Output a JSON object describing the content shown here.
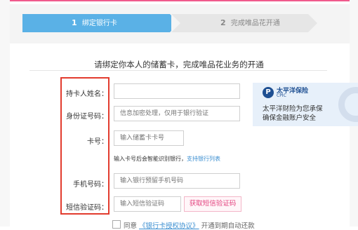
{
  "steps": [
    {
      "num": "1",
      "label": "绑定银行卡",
      "active": true
    },
    {
      "num": "2",
      "label": "完成唯品花开通",
      "active": false
    }
  ],
  "intro": "请绑定你本人的储蓄卡，完成唯品花业务的开通",
  "form": {
    "name_label": "持卡人姓名：",
    "name_value": "",
    "id_label": "身份证号码：",
    "id_placeholder": "信息加密处理，仅用于银行验证",
    "card_label": "卡号：",
    "card_placeholder": "输入储蓄卡卡号",
    "card_hint": "输入卡号后会智能识别银行，",
    "card_hint_link": "支持银行列表",
    "phone_label": "手机号码：",
    "phone_placeholder": "输入银行预留手机号码",
    "sms_label": "短信验证码：",
    "sms_placeholder": "输入短信验证码",
    "sms_button": "获取短信验证码"
  },
  "promo": {
    "brand": "太平洋保险",
    "brand_sub": "CPIC",
    "line1": "太平洋财险为您承保",
    "line2": "确保金融账户安全",
    "logo_icon": "cpic-logo-icon"
  },
  "agreement": {
    "prefix": "同意",
    "link": "《银行卡授权协议》",
    "suffix": "开通到期自动还款"
  },
  "colors": {
    "accent_pink": "#f05a8c",
    "step_active": "#5ab1e6",
    "highlight_red": "#e23b2e",
    "link_blue": "#3c8fd1"
  }
}
